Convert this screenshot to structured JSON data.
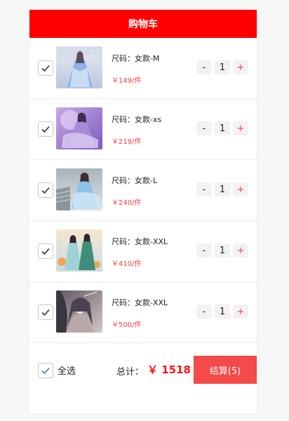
{
  "header": {
    "title": "购物车"
  },
  "items": [
    {
      "size": "尺码：女款-M",
      "price": "￥149/件",
      "qty": "1",
      "minus": "-",
      "plus": "+"
    },
    {
      "size": "尺码：女款-xs",
      "price": "￥219/件",
      "qty": "1",
      "minus": "-",
      "plus": "+"
    },
    {
      "size": "尺码：女款-L",
      "price": "￥240/件",
      "qty": "1",
      "minus": "-",
      "plus": "+"
    },
    {
      "size": "尺码：女款-XXL",
      "price": "￥410/件",
      "qty": "1",
      "minus": "-",
      "plus": "+"
    },
    {
      "size": "尺码：女款-XXL",
      "price": "￥500/件",
      "qty": "1",
      "minus": "-",
      "plus": "+"
    }
  ],
  "footer": {
    "select_all": "全选",
    "total_label": "总计：",
    "total_amount": "￥ 1518",
    "checkout": "结算(5)"
  },
  "icons": {
    "item_check": "checkmark-icon",
    "select_all_check": "checkmark-icon"
  },
  "colors": {
    "header": "#ff0000",
    "price": "#ff3b3b",
    "checkout": "#f54a4a",
    "select_all_check": "#3a7bd5"
  }
}
